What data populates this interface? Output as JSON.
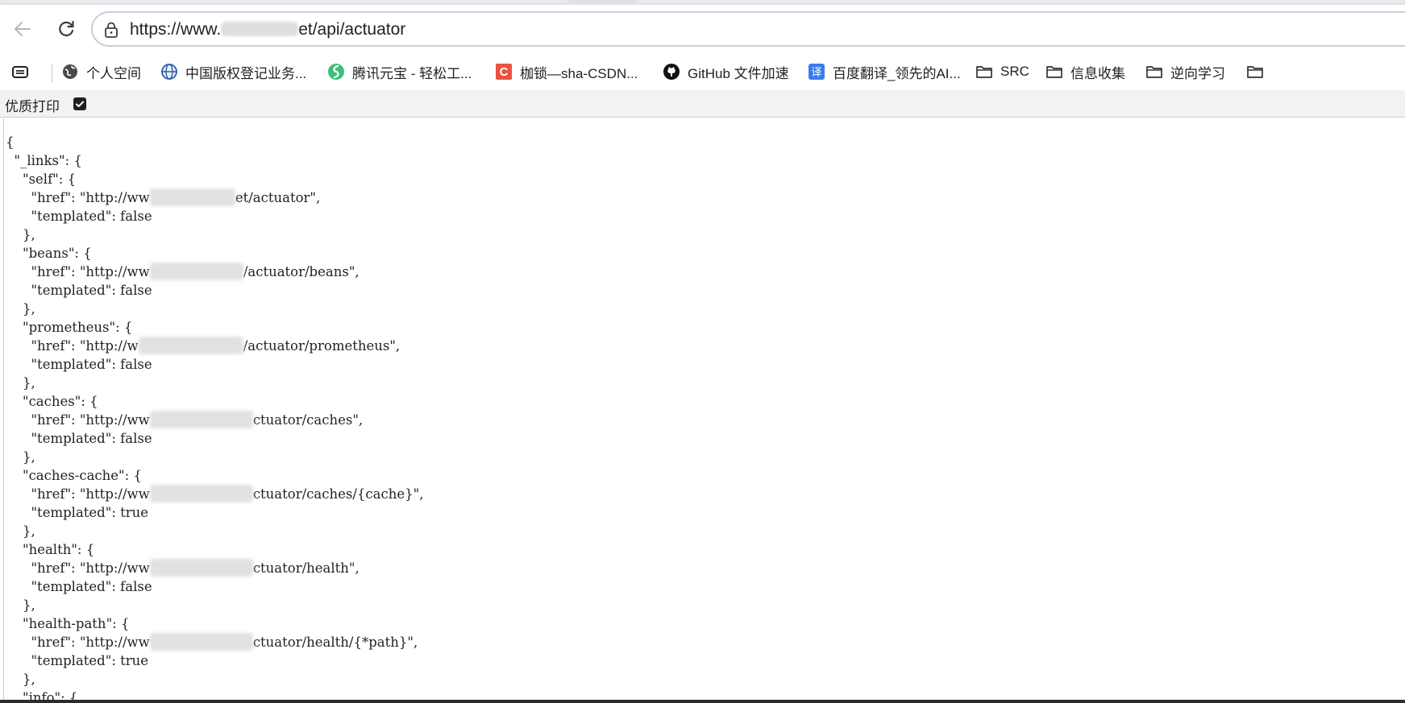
{
  "browser": {
    "address_bar": {
      "url_visible_prefix": "https://www.",
      "url_visible_suffix": "et/api/actuator"
    },
    "bookmarks": [
      {
        "label": "个人空间",
        "icon": "globe-icon"
      },
      {
        "label": "中国版权登记业务...",
        "icon": "copyright-globe-icon"
      },
      {
        "label": "腾讯元宝 - 轻松工...",
        "icon": "yuanbao-icon"
      },
      {
        "label": "枷锁—sha-CSDN...",
        "icon": "csdn-icon"
      },
      {
        "label": "GitHub 文件加速",
        "icon": "github-icon"
      },
      {
        "label": "百度翻译_领先的AI...",
        "icon": "translate-icon"
      },
      {
        "label": "SRC",
        "icon": "folder-icon"
      },
      {
        "label": "信息收集",
        "icon": "folder-icon"
      },
      {
        "label": "逆向学习",
        "icon": "folder-icon"
      }
    ]
  },
  "pretty_print": {
    "label": "优质打印",
    "checked": true
  },
  "json_view": {
    "lines": [
      {
        "pre": "{",
        "post": ""
      },
      {
        "pre": "  \"_links\": {",
        "post": ""
      },
      {
        "pre": "    \"self\": {",
        "post": ""
      },
      {
        "pre": "      \"href\": \"http://ww",
        "post": "et/actuator\","
      },
      {
        "pre": "      \"templated\": false",
        "post": ""
      },
      {
        "pre": "    },",
        "post": ""
      },
      {
        "pre": "    \"beans\": {",
        "post": ""
      },
      {
        "pre": "      \"href\": \"http://ww",
        "post": "/actuator/beans\","
      },
      {
        "pre": "      \"templated\": false",
        "post": ""
      },
      {
        "pre": "    },",
        "post": ""
      },
      {
        "pre": "    \"prometheus\": {",
        "post": ""
      },
      {
        "pre": "      \"href\": \"http://w",
        "post": "/actuator/prometheus\","
      },
      {
        "pre": "      \"templated\": false",
        "post": ""
      },
      {
        "pre": "    },",
        "post": ""
      },
      {
        "pre": "    \"caches\": {",
        "post": ""
      },
      {
        "pre": "      \"href\": \"http://ww",
        "post": "ctuator/caches\","
      },
      {
        "pre": "      \"templated\": false",
        "post": ""
      },
      {
        "pre": "    },",
        "post": ""
      },
      {
        "pre": "    \"caches-cache\": {",
        "post": ""
      },
      {
        "pre": "      \"href\": \"http://ww",
        "post": "ctuator/caches/{cache}\","
      },
      {
        "pre": "      \"templated\": true",
        "post": ""
      },
      {
        "pre": "    },",
        "post": ""
      },
      {
        "pre": "    \"health\": {",
        "post": ""
      },
      {
        "pre": "      \"href\": \"http://ww",
        "post": "ctuator/health\","
      },
      {
        "pre": "      \"templated\": false",
        "post": ""
      },
      {
        "pre": "    },",
        "post": ""
      },
      {
        "pre": "    \"health-path\": {",
        "post": ""
      },
      {
        "pre": "      \"href\": \"http://ww",
        "post": "ctuator/health/{*path}\","
      },
      {
        "pre": "      \"templated\": true",
        "post": ""
      },
      {
        "pre": "    },",
        "post": ""
      },
      {
        "pre": "    \"info\": {",
        "post": ""
      }
    ]
  }
}
